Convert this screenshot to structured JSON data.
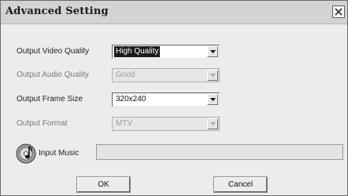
{
  "window": {
    "title": "Advanced Setting"
  },
  "settings": [
    {
      "label": "Output Video Quality",
      "value": "High Quality",
      "enabled": true
    },
    {
      "label": "Output Audio Quality",
      "value": "Good",
      "enabled": false
    },
    {
      "label": "Output Frame Size",
      "value": "320x240",
      "enabled": true
    },
    {
      "label": "Output Format",
      "value": "MTV",
      "enabled": false
    }
  ],
  "music": {
    "label": "Input Music",
    "value": ""
  },
  "buttons": {
    "ok_label": "OK",
    "cancel_label": "Cancel"
  },
  "icons": {
    "close": "close-icon",
    "dropdown": "chevron-down-icon",
    "music": "music-disc-icon"
  }
}
